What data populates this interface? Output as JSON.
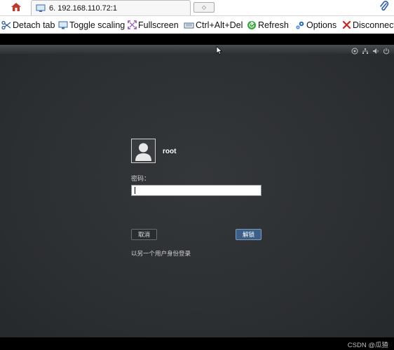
{
  "tabbar": {
    "tab_label": "6. 192.168.110.72:1"
  },
  "toolbar": {
    "detach_tab": "Detach tab",
    "toggle_scaling": "Toggle scaling",
    "fullscreen": "Fullscreen",
    "ctrl_alt_del": "Ctrl+Alt+Del",
    "refresh": "Refresh",
    "options": "Options",
    "disconnect": "Disconnect"
  },
  "lock_screen": {
    "username": "root",
    "password_label": "密码：",
    "password_value": "",
    "cancel_button": "取消",
    "unlock_button": "解锁",
    "switch_user_link": "以另一个用户身份登录"
  },
  "watermark": "CSDN @瓜猹",
  "colors": {
    "background": "#2c2f31",
    "unlock_button": "#3b5f86",
    "refresh_icon": "#3aa83a",
    "disconnect_icon": "#d32020",
    "options_icon": "#2a6fcf"
  }
}
